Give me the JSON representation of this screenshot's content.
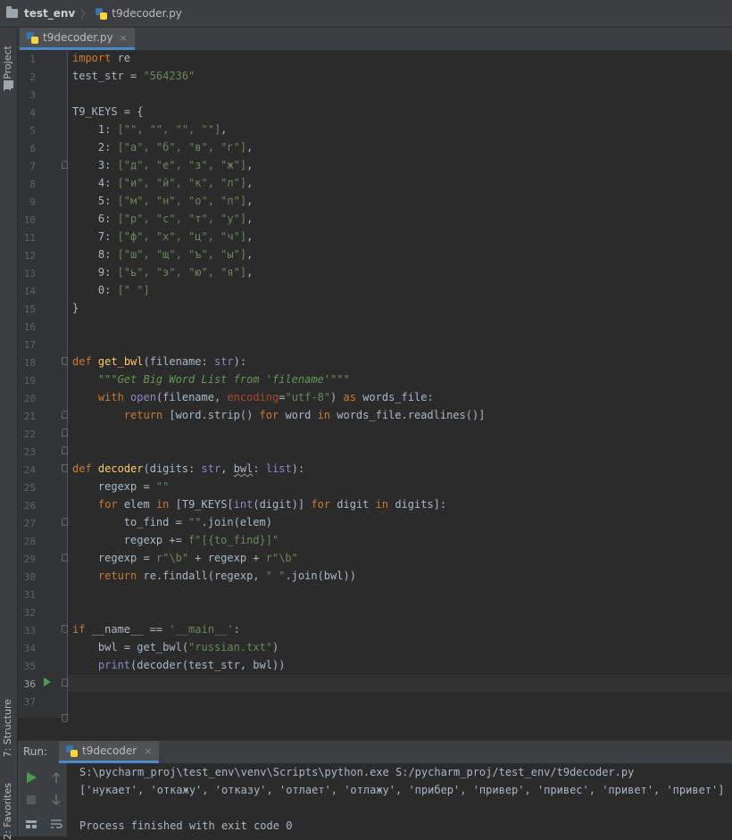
{
  "breadcrumb": {
    "project": "test_env",
    "file": "t9decoder.py"
  },
  "tool_windows": {
    "project": "1: Project",
    "structure": "7: Structure",
    "favorites": "2: Favorites"
  },
  "editor_tab": {
    "label": "t9decoder.py",
    "close": "×"
  },
  "editor": {
    "line_numbers": [
      "1",
      "2",
      "3",
      "4",
      "5",
      "6",
      "7",
      "8",
      "9",
      "10",
      "11",
      "12",
      "13",
      "14",
      "15",
      "16",
      "17",
      "18",
      "19",
      "20",
      "21",
      "22",
      "23",
      "24",
      "25",
      "26",
      "27",
      "28",
      "29",
      "30",
      "31",
      "32",
      "33",
      "34",
      "35",
      "36",
      "37"
    ],
    "current_line": "36",
    "str_test": "\"564236\"",
    "k1": "[\"\", \"\", \"\", \"\"]",
    "k2": "[\"а\", \"б\", \"в\", \"г\"]",
    "k3": "[\"д\", \"е\", \"з\", \"ж\"]",
    "k4": "[\"и\", \"й\", \"к\", \"л\"]",
    "k5": "[\"м\", \"н\", \"о\", \"п\"]",
    "k6": "[\"р\", \"с\", \"т\", \"у\"]",
    "k7": "[\"ф\", \"х\", \"ц\", \"ч\"]",
    "k8": "[\"ш\", \"щ\", \"ъ\", \"ы\"]",
    "k9": "[\"ь\", \"э\", \"ю\", \"я\"]",
    "k0": "[\" \"]",
    "docstring": "\"\"\"Get Big Word List from 'filename'\"\"\"",
    "utf8": "\"utf-8\"",
    "empty_str": "\"\"",
    "fstring": "f\"[{to_find}]\"",
    "raw_b": "r\"\\b\"",
    "space_str": "\" \"",
    "main_str": "'__main__'",
    "russian": "\"russian.txt\""
  },
  "run_panel": {
    "label": "Run:",
    "tab": "t9decoder",
    "close": "×",
    "output": [
      "S:\\pycharm_proj\\test_env\\venv\\Scripts\\python.exe S:/pycharm_proj/test_env/t9decoder.py",
      "['нукает', 'откажу', 'отказу', 'отлает', 'отлажу', 'прибер', 'привер', 'привес', 'привет', 'привет']",
      "",
      "Process finished with exit code 0"
    ]
  },
  "colors": {
    "keyword": "#cc7832",
    "string": "#6a8759",
    "function": "#ffc66d",
    "builtin": "#8888c6",
    "accent": "#4a88c7",
    "run_green": "#499c54"
  }
}
